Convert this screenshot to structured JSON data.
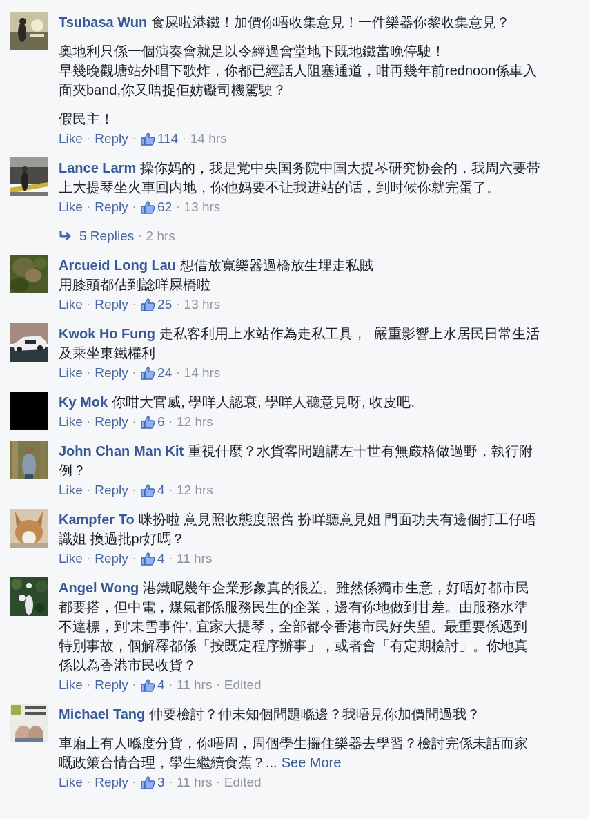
{
  "comments": [
    {
      "author": "Tsubasa Wun",
      "avatar": {
        "kind": "picture"
      },
      "paragraphs": [
        [
          "食屎啦港鐵！加價你唔收集意見！一件樂器你黎收集意見？"
        ],
        [
          "奧地利只係一個演奏會就足以令經過會堂地下既地鐵當晚停駛！",
          "早幾晚觀塘站外唱下歌炸，你都已經話人阻塞通道，咁再幾年前rednoon係車入",
          "面夾band,你又唔捉佢妨礙司機駕駛？"
        ],
        [
          "假民主！"
        ]
      ],
      "actions": [
        {
          "kind": "link",
          "text": "Like"
        },
        {
          "kind": "separator",
          "text": "·"
        },
        {
          "kind": "link",
          "text": "Reply"
        },
        {
          "kind": "separator",
          "text": "·"
        },
        {
          "kind": "likes",
          "text": "114"
        },
        {
          "kind": "separator",
          "text": "·"
        },
        {
          "kind": "meta",
          "text": "14 hrs"
        }
      ]
    },
    {
      "author": "Lance Larm",
      "avatar": {
        "kind": "picture"
      },
      "paragraphs": [
        [
          "操你妈的，我是党中央国务院中国大提琴研究协会的，我周六要带",
          "上大提琴坐火車回内地，你他妈要不让我进站的话，到时候你就完蛋了。"
        ]
      ],
      "actions": [
        {
          "kind": "link",
          "text": "Like"
        },
        {
          "kind": "separator",
          "text": "·"
        },
        {
          "kind": "link",
          "text": "Reply"
        },
        {
          "kind": "separator",
          "text": "·"
        },
        {
          "kind": "likes",
          "text": "62"
        },
        {
          "kind": "separator",
          "text": "·"
        },
        {
          "kind": "meta",
          "text": "13 hrs"
        }
      ],
      "replies": [
        {
          "kind": "link",
          "text": "5 Replies"
        },
        {
          "kind": "separator",
          "text": "·"
        },
        {
          "kind": "meta",
          "text": "2 hrs"
        }
      ]
    },
    {
      "author": "Arcueid Long Lau",
      "avatar": {
        "kind": "picture"
      },
      "paragraphs": [
        [
          "想借放寬樂器過橋放生埋走私賊",
          "用膝頭都估到諗咩屎橋啦"
        ]
      ],
      "actions": [
        {
          "kind": "link",
          "text": "Like"
        },
        {
          "kind": "separator",
          "text": "·"
        },
        {
          "kind": "link",
          "text": "Reply"
        },
        {
          "kind": "separator",
          "text": "·"
        },
        {
          "kind": "likes",
          "text": "25"
        },
        {
          "kind": "separator",
          "text": "·"
        },
        {
          "kind": "meta",
          "text": "13 hrs"
        }
      ]
    },
    {
      "author": "Kwok Ho Fung",
      "avatar": {
        "kind": "picture"
      },
      "paragraphs": [
        [
          "走私客利用上水站作為走私工具，  嚴重影響上水居民日常生活",
          "及乘坐東鐵權利"
        ]
      ],
      "actions": [
        {
          "kind": "link",
          "text": "Like"
        },
        {
          "kind": "separator",
          "text": "·"
        },
        {
          "kind": "link",
          "text": "Reply"
        },
        {
          "kind": "separator",
          "text": "·"
        },
        {
          "kind": "likes",
          "text": "24"
        },
        {
          "kind": "separator",
          "text": "·"
        },
        {
          "kind": "meta",
          "text": "14 hrs"
        }
      ]
    },
    {
      "author": "Ky Mok",
      "avatar": {
        "kind": "picture"
      },
      "paragraphs": [
        [
          "你咁大官威, 學咩人認衰, 學咩人聽意見呀, 收皮吧."
        ]
      ],
      "actions": [
        {
          "kind": "link",
          "text": "Like"
        },
        {
          "kind": "separator",
          "text": "·"
        },
        {
          "kind": "link",
          "text": "Reply"
        },
        {
          "kind": "separator",
          "text": "·"
        },
        {
          "kind": "likes",
          "text": "6"
        },
        {
          "kind": "separator",
          "text": "·"
        },
        {
          "kind": "meta",
          "text": "12 hrs"
        }
      ]
    },
    {
      "author": "John Chan Man Kit",
      "avatar": {
        "kind": "picture"
      },
      "paragraphs": [
        [
          "重視什麼？水貨客問題講左十世有無嚴格做過野，執行附",
          "例？"
        ]
      ],
      "actions": [
        {
          "kind": "link",
          "text": "Like"
        },
        {
          "kind": "separator",
          "text": "·"
        },
        {
          "kind": "link",
          "text": "Reply"
        },
        {
          "kind": "separator",
          "text": "·"
        },
        {
          "kind": "likes",
          "text": "4"
        },
        {
          "kind": "separator",
          "text": "·"
        },
        {
          "kind": "meta",
          "text": "12 hrs"
        }
      ]
    },
    {
      "author": "Kampfer To",
      "avatar": {
        "kind": "picture"
      },
      "paragraphs": [
        [
          "咪扮啦 意見照收態度照舊 扮咩聽意見姐 門面功夫有邊個打工仔唔",
          "識姐 換過批pr好嗎？"
        ]
      ],
      "actions": [
        {
          "kind": "link",
          "text": "Like"
        },
        {
          "kind": "separator",
          "text": "·"
        },
        {
          "kind": "link",
          "text": "Reply"
        },
        {
          "kind": "separator",
          "text": "·"
        },
        {
          "kind": "likes",
          "text": "4"
        },
        {
          "kind": "separator",
          "text": "·"
        },
        {
          "kind": "meta",
          "text": "11 hrs"
        }
      ]
    },
    {
      "author": "Angel Wong",
      "avatar": {
        "kind": "picture"
      },
      "paragraphs": [
        [
          "港鐵呢幾年企業形象真的很差。雖然係獨市生意，好唔好都市民",
          "都要搭，但中電，煤氣都係服務民生的企業，邊有你地做到甘差。由服務水準",
          "不達標，到'未雪事件', 宜家大提琴，全部都令香港市民好失望。最重要係遇到",
          "特別事故，個解釋都係「按既定程序辦事」，或者會「有定期檢討」。你地真",
          "係以為香港市民收貨？"
        ]
      ],
      "actions": [
        {
          "kind": "link",
          "text": "Like"
        },
        {
          "kind": "separator",
          "text": "·"
        },
        {
          "kind": "link",
          "text": "Reply"
        },
        {
          "kind": "separator",
          "text": "·"
        },
        {
          "kind": "likes",
          "text": "4"
        },
        {
          "kind": "separator",
          "text": "·"
        },
        {
          "kind": "meta",
          "text": "11 hrs"
        },
        {
          "kind": "separator",
          "text": "·"
        },
        {
          "kind": "meta",
          "text": "Edited"
        }
      ]
    },
    {
      "author": "Michael Tang",
      "avatar": {
        "kind": "picture"
      },
      "paragraphs": [
        [
          "仲要檢討？仲未知個問題喺邊？我唔見你加價問過我？"
        ],
        [
          "車廂上有人喺度分貨，你唔周，周個學生攞住樂器去學習？檢討完係未話而家",
          "嘅政策合情合理，學生繼續食蕉？..."
        ]
      ],
      "see_more": "See More",
      "actions": [
        {
          "kind": "link",
          "text": "Like"
        },
        {
          "kind": "separator",
          "text": "·"
        },
        {
          "kind": "link",
          "text": "Reply"
        },
        {
          "kind": "separator",
          "text": "·"
        },
        {
          "kind": "likes",
          "text": "3"
        },
        {
          "kind": "separator",
          "text": "·"
        },
        {
          "kind": "meta",
          "text": "11 hrs"
        },
        {
          "kind": "separator",
          "text": "·"
        },
        {
          "kind": "meta",
          "text": "Edited"
        }
      ]
    }
  ]
}
